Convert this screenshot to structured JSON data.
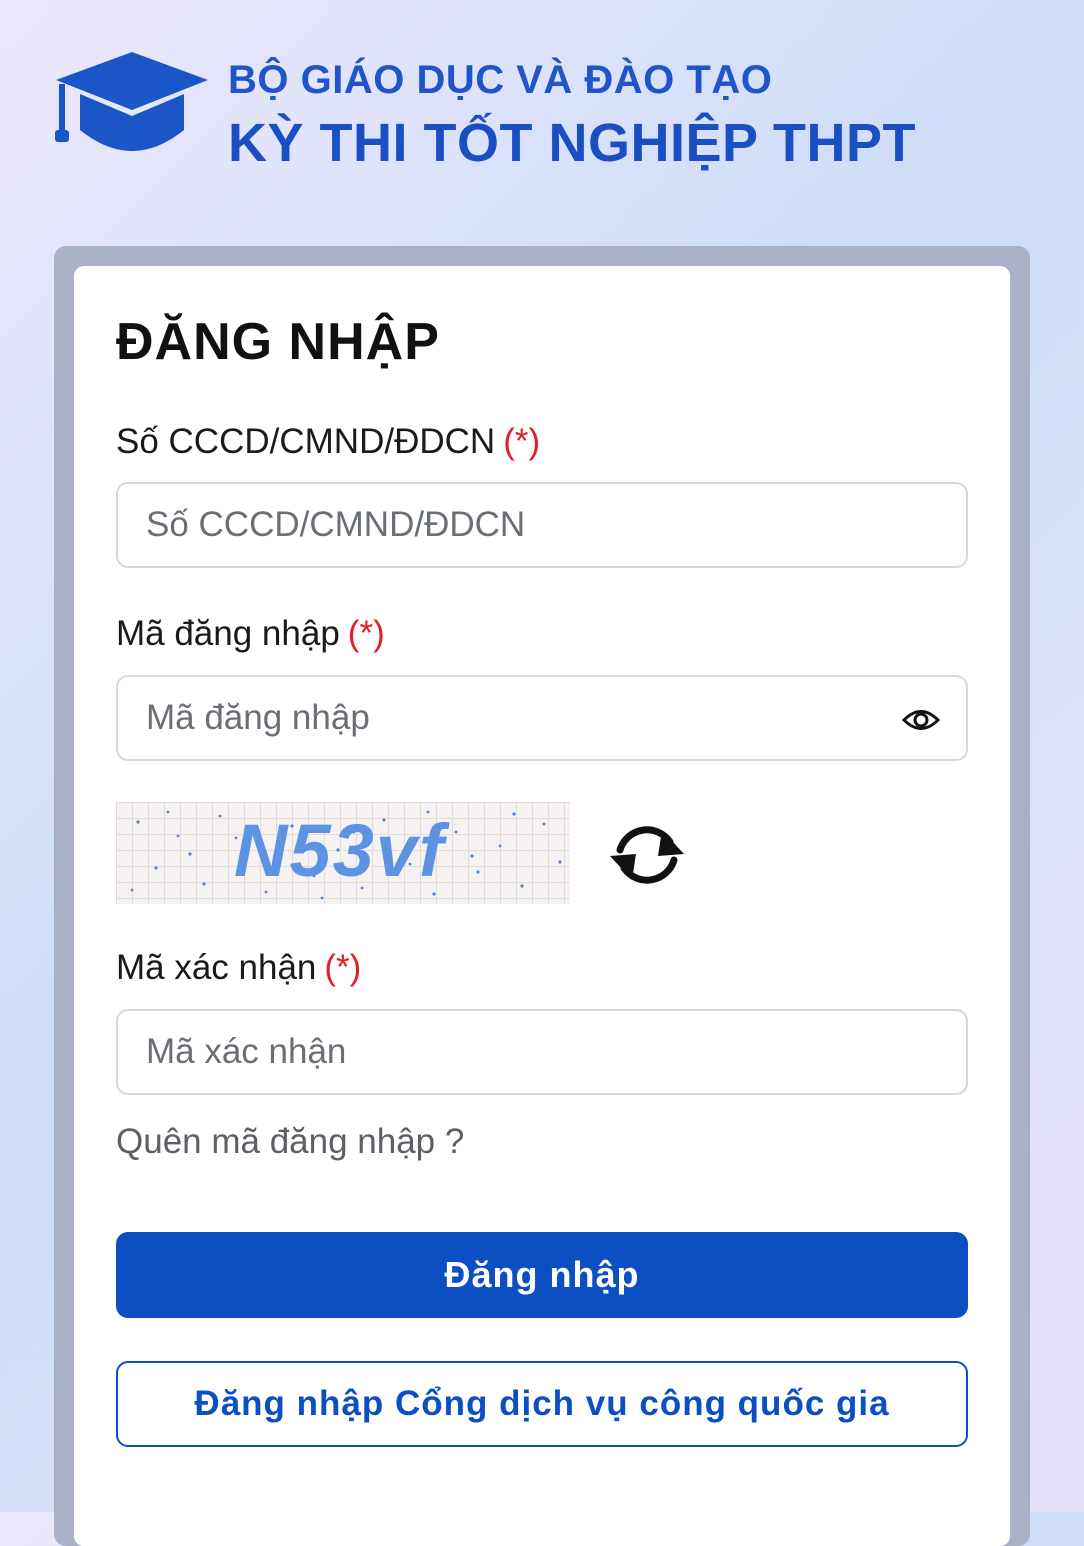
{
  "header": {
    "org_name": "BỘ GIÁO DỤC VÀ ĐÀO TẠO",
    "exam_name": "KỲ THI TỐT NGHIỆP THPT",
    "logo_icon": "graduation-cap-icon"
  },
  "form": {
    "title": "ĐĂNG NHẬP",
    "required_mark": "(*)",
    "id_field": {
      "label": "Số CCCD/CMND/ĐDCN",
      "placeholder": "Số CCCD/CMND/ĐDCN",
      "value": ""
    },
    "password_field": {
      "label": "Mã đăng nhập",
      "placeholder": "Mã đăng nhập",
      "value": "",
      "toggle_icon": "eye-icon"
    },
    "captcha": {
      "text": "N53vf",
      "refresh_icon": "refresh-icon"
    },
    "captcha_field": {
      "label": "Mã xác nhận",
      "placeholder": "Mã xác nhận",
      "value": ""
    },
    "forgot_link": "Quên mã đăng nhập ?",
    "login_button": "Đăng nhập",
    "gov_login_button": "Đăng nhập Cổng dịch vụ công quốc gia"
  },
  "colors": {
    "brand_blue": "#0c4fc2",
    "header_blue": "#1f55c9",
    "required_red": "#e01f26",
    "captcha_text": "#5d93e3"
  }
}
